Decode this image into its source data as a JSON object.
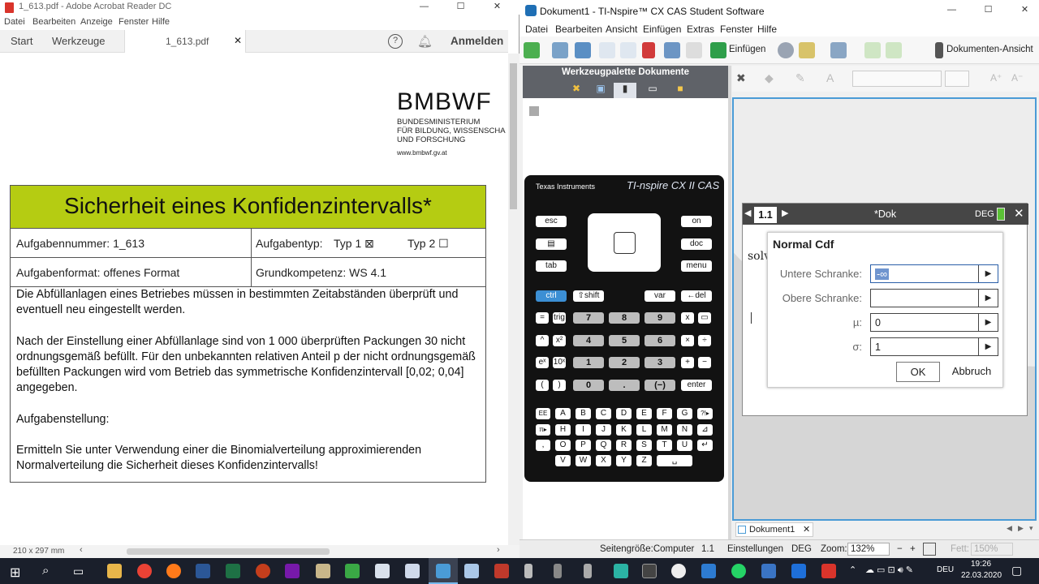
{
  "acrobat": {
    "title": "1_613.pdf - Adobe Acrobat Reader DC",
    "menu": [
      "Datei",
      "Bearbeiten",
      "Anzeige",
      "Fenster",
      "Hilfe"
    ],
    "tabs": {
      "start": "Start",
      "tools": "Werkzeuge",
      "doc": "1_613.pdf",
      "signin": "Anmelden"
    },
    "logo": {
      "name": "BMBWF",
      "line1": "BUNDESMINISTERIUM",
      "line2": "FÜR BILDUNG, WISSENSCHA",
      "line3": "UND FORSCHUNG",
      "url": "www.bmbwf.gv.at"
    },
    "task": {
      "title": "Sicherheit eines Konfidenzintervalls*",
      "number": "Aufgabennummer: 1_613",
      "type_label": "Aufgabentyp:",
      "type1": "Typ 1 ⊠",
      "type2": "Typ 2 ☐",
      "format": "Aufgabenformat: offenes Format",
      "competence": "Grundkompetenz: WS 4.1",
      "para1": "Die Abfüllanlagen eines Betriebes müssen in bestimmten Zeitabständen überprüft und eventuell neu eingestellt werden.",
      "para2": "Nach der Einstellung einer Abfüllanlage sind von 1 000 überprüften Packungen 30 nicht ordnungsgemäß befüllt. Für den unbekannten relativen Anteil p der nicht ordnungsgemäß befüllten Packungen wird vom Betrieb das symmetrische Konfidenzintervall [0,02; 0,04] angegeben.",
      "heading": "Aufgabenstellung:",
      "para3": "Ermitteln Sie unter Verwendung einer die Binomialverteilung approximierenden Normalverteilung die Sicherheit dieses Konfidenzintervalls!"
    },
    "status": "210 x 297 mm"
  },
  "ti": {
    "title": "Dokument1 - TI-Nspire™ CX CAS Student Software",
    "menu": [
      "Datei",
      "Bearbeiten",
      "Ansicht",
      "Einfügen",
      "Extras",
      "Fenster",
      "Hilfe"
    ],
    "toolbar": {
      "insert": "Einfügen",
      "view": "Dokumenten-Ansicht"
    },
    "palette_title": "Werkzeugpalette Dokumente",
    "calc": {
      "brand": "Texas Instruments",
      "model": "TI-nspire CX II CAS",
      "keys": {
        "esc": "esc",
        "on": "on",
        "doc": "doc",
        "tab": "tab",
        "menu": "menu",
        "ctrl": "ctrl",
        "shift": "⇧shift",
        "var": "var",
        "del": "←del",
        "n7": "7",
        "n8": "8",
        "n9": "9",
        "n4": "4",
        "n5": "5",
        "n6": "6",
        "n1": "1",
        "n2": "2",
        "n3": "3",
        "n0": "0",
        "dot": ".",
        "neg": "(−)",
        "enter": "enter",
        "mul": "×",
        "div": "÷",
        "plus": "+",
        "minus": "−",
        "lp": "(",
        "rp": ")"
      },
      "alpha_rows": [
        [
          "EE",
          "A",
          "B",
          "C",
          "D",
          "E",
          "F",
          "G",
          "?!▸"
        ],
        [
          "π▸",
          "H",
          "I",
          "J",
          "K",
          "L",
          "M",
          "N",
          "⊿"
        ],
        [
          ",",
          "O",
          "P",
          "Q",
          "R",
          "S",
          "T",
          "U",
          "↵"
        ],
        [
          "V",
          "W",
          "X",
          "Y",
          "Z",
          "␣"
        ]
      ]
    },
    "page": {
      "tab": "1.1",
      "doc": "*Dok",
      "mode": "DEG",
      "bg_text": "solv",
      "dialog": {
        "title": "Normal Cdf",
        "lower_label": "Untere Schranke:",
        "lower_value": "-∞",
        "upper_label": "Obere Schranke:",
        "upper_value": "",
        "mu_label": "µ:",
        "mu_value": "0",
        "sigma_label": "σ:",
        "sigma_value": "1",
        "ok": "OK",
        "cancel": "Abbruch"
      }
    },
    "doc_tab": "Dokument1",
    "status": {
      "pagesize": "Seitengröße:Computer",
      "page": "1.1",
      "settings": "Einstellungen",
      "mode": "DEG",
      "zoom_label": "Zoom:",
      "zoom": "132%",
      "bold": "Fett:",
      "bold_value": "150%"
    }
  },
  "taskbar": {
    "lang": "DEU",
    "time": "19:26",
    "date": "22.03.2020"
  },
  "colors": {
    "task_header": "#b5cc12",
    "ti_accent": "#4a9bd6",
    "taskbar": "#1a1f2b"
  }
}
